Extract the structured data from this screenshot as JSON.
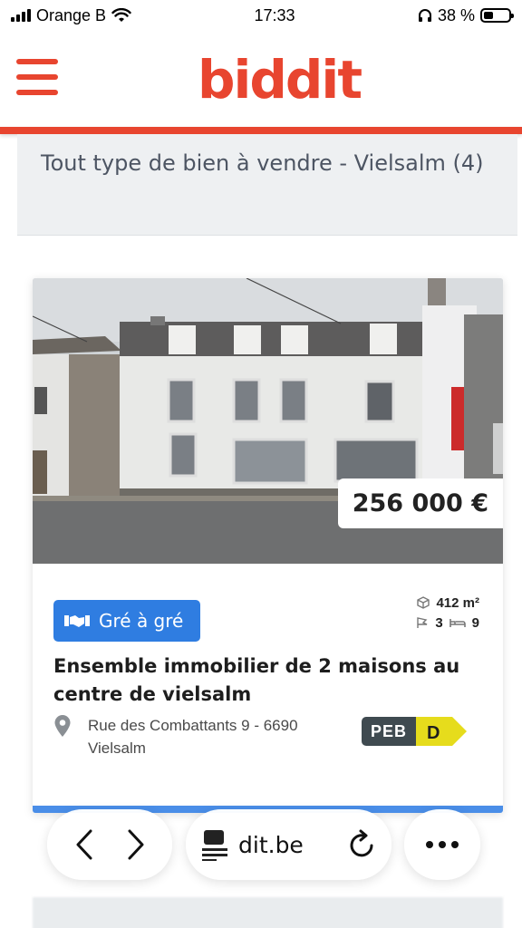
{
  "status_bar": {
    "carrier": "Orange B",
    "time": "17:33",
    "battery": "38 %",
    "battery_level": 0.38
  },
  "header": {
    "logo": "biddit"
  },
  "page": {
    "title": "Tout type de bien à vendre - Vielsalm (4)"
  },
  "listing": {
    "price": "256 000 €",
    "sale_type": "Gré à gré",
    "surface": "412 m²",
    "rooms": "3",
    "bedrooms": "9",
    "title": "Ensemble immobilier de 2 maisons au centre de vielsalm",
    "address": "Rue des Combattants 9 - 6690 Vielsalm",
    "peb_label": "PEB",
    "peb_class": "D",
    "peb_color": "#e6dc1c"
  },
  "browser": {
    "url": "dit.be"
  },
  "colors": {
    "brand": "#e8452f",
    "badge": "#2f7de1",
    "title": "#4d5563"
  }
}
